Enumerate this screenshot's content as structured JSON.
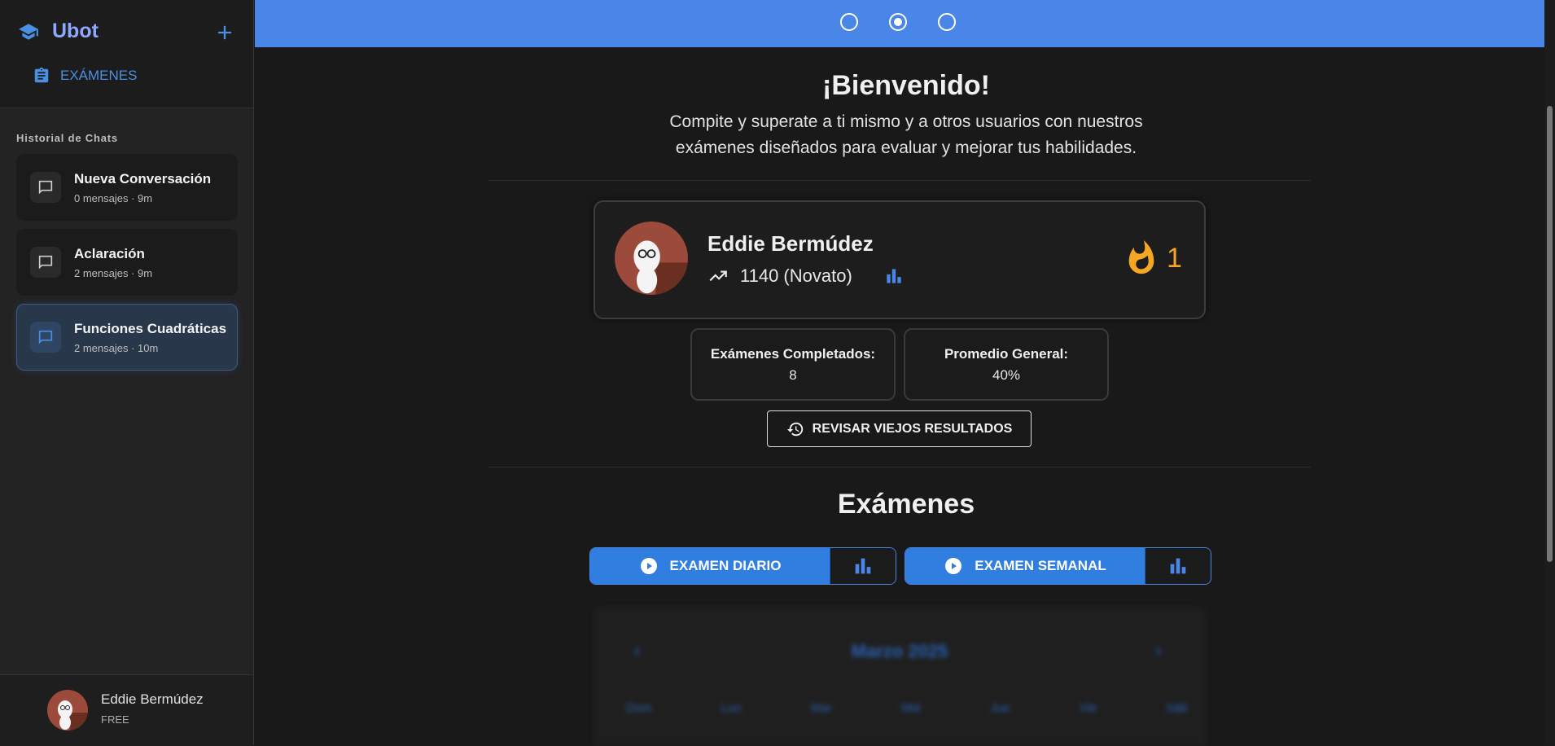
{
  "sidebar": {
    "brand": "Ubot",
    "exams_link": "EXÁMENES",
    "history_label": "Historial de Chats",
    "chats": [
      {
        "title": "Nueva Conversación",
        "meta": "0 mensajes · 9m"
      },
      {
        "title": "Aclaración",
        "meta": "2 mensajes · 9m"
      },
      {
        "title": "Funciones Cuadráticas",
        "meta": "2 mensajes · 10m"
      }
    ],
    "user": {
      "name": "Eddie Bermúdez",
      "plan": "FREE"
    }
  },
  "main": {
    "welcome_title": "¡Bienvenido!",
    "welcome_line1": "Compite y superate a ti mismo y a otros usuarios con nuestros",
    "welcome_line2": "exámenes diseñados para evaluar y mejorar tus habilidades.",
    "profile": {
      "name": "Eddie Bermúdez",
      "rating": "1140 (Novato)",
      "streak": "1"
    },
    "stats": [
      {
        "label": "Exámenes Completados:",
        "value": "8"
      },
      {
        "label": "Promedio General:",
        "value": "40%"
      }
    ],
    "review_button": "REVISAR VIEJOS RESULTADOS",
    "exams_title": "Exámenes",
    "daily_exam": "EXAMEN DIARIO",
    "weekly_exam": "EXAMEN SEMANAL",
    "calendar": {
      "month": "Marzo 2025",
      "days": [
        "Dom",
        "Lun",
        "Mar",
        "Mié",
        "Jue",
        "Vie",
        "Sáb"
      ]
    }
  },
  "colors": {
    "accent": "#4a85e8",
    "brand": "#8fa8ff",
    "streak": "#f5a623"
  }
}
